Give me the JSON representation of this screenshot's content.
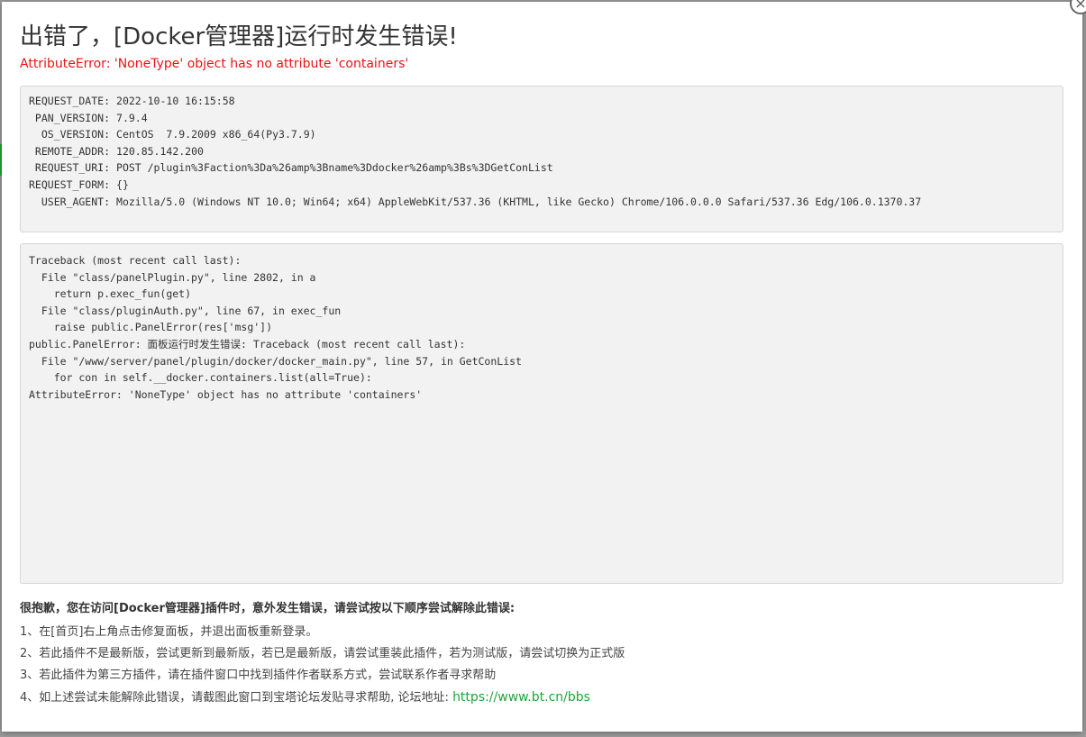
{
  "dialog": {
    "title": "出错了，[Docker管理器]运行时发生错误!",
    "error_message": "AttributeError: 'NoneType' object has no attribute 'containers'",
    "close_symbol": "×"
  },
  "request_info": [
    {
      "key": "REQUEST_DATE:",
      "value": "2022-10-10 16:15:58"
    },
    {
      "key": "PAN_VERSION:",
      "value": "7.9.4"
    },
    {
      "key": "OS_VERSION:",
      "value": "CentOS  7.9.2009 x86_64(Py3.7.9)"
    },
    {
      "key": "REMOTE_ADDR:",
      "value": "120.85.142.200"
    },
    {
      "key": "REQUEST_URI:",
      "value": "POST /plugin%3Faction%3Da%26amp%3Bname%3Ddocker%26amp%3Bs%3DGetConList"
    },
    {
      "key": "REQUEST_FORM:",
      "value": "{}"
    },
    {
      "key": "USER_AGENT:",
      "value": "Mozilla/5.0 (Windows NT 10.0; Win64; x64) AppleWebKit/537.36 (KHTML, like Gecko) Chrome/106.0.0.0 Safari/537.36 Edg/106.0.1370.37"
    }
  ],
  "traceback": [
    "Traceback (most recent call last):",
    "  File \"class/panelPlugin.py\", line 2802, in a",
    "    return p.exec_fun(get)",
    "  File \"class/pluginAuth.py\", line 67, in exec_fun",
    "    raise public.PanelError(res['msg'])",
    "public.PanelError: 面板运行时发生错误: Traceback (most recent call last):",
    "  File \"/www/server/panel/plugin/docker/docker_main.py\", line 57, in GetConList",
    "    for con in self.__docker.containers.list(all=True):",
    "AttributeError: 'NoneType' object has no attribute 'containers'"
  ],
  "help": {
    "heading": "很抱歉，您在访问[Docker管理器]插件时，意外发生错误，请尝试按以下顺序尝试解除此错误:",
    "items": [
      "1、在[首页]右上角点击修复面板，并退出面板重新登录。",
      "2、若此插件不是最新版，尝试更新到最新版，若已是最新版，请尝试重装此插件，若为测试版，请尝试切换为正式版",
      "3、若此插件为第三方插件，请在插件窗口中找到插件作者联系方式，尝试联系作者寻求帮助"
    ],
    "last_item_text": "4、如上述尝试未能解除此错误，请截图此窗口到宝塔论坛发贴寻求帮助, 论坛地址: ",
    "forum_link": "https://www.bt.cn/bbs"
  },
  "colors": {
    "error_red": "#ee1111",
    "link_green": "#20a53a",
    "box_bg": "#f2f2f2"
  }
}
